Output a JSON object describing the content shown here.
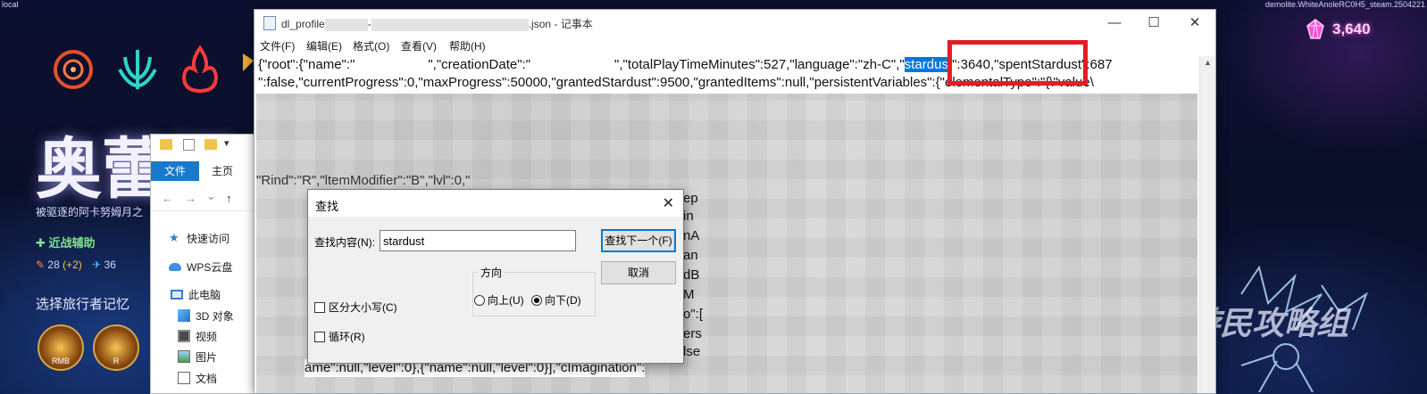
{
  "game": {
    "corner_left": "local",
    "corner_right": "demolite.WhiteAnoleRC0H5_steam.2504221",
    "title": "奥蕾娜",
    "subtitle": "被驱逐的阿卡努姆月之",
    "skill": "近战辅助",
    "stat1": "28",
    "stat1_delta": "(+2)",
    "stat2": "36",
    "memory_title": "选择旅行者记忆",
    "memory_keys": [
      "RMB",
      "R"
    ],
    "currency_value": "3,640",
    "watermark": "游民攻略组",
    "colors": {
      "currency_glow": "#ff4fd8",
      "skill_green": "#7ee38a"
    }
  },
  "explorer": {
    "ribbon": {
      "file": "文件",
      "home": "主页"
    },
    "nav": {
      "back": "←",
      "forward": "→",
      "dropdown": "⌄",
      "up": "↑"
    },
    "tree": [
      {
        "label": "快速访问",
        "icon": "star-icon"
      },
      {
        "label": "WPS云盘",
        "icon": "cloud-icon"
      },
      {
        "label": "此电脑",
        "icon": "computer-icon"
      },
      {
        "label": "3D 对象",
        "icon": "cube-icon"
      },
      {
        "label": "视频",
        "icon": "video-icon"
      },
      {
        "label": "图片",
        "icon": "picture-icon"
      },
      {
        "label": "文档",
        "icon": "document-icon"
      }
    ]
  },
  "notepad": {
    "title_prefix": "dl_profile",
    "title_suffix": ".json - 记事本",
    "controls": {
      "minimize": "—",
      "maximize": "☐",
      "close": "✕"
    },
    "menu": [
      "文件(F)",
      "编辑(E)",
      "格式(O)",
      "查看(V)",
      "帮助(H)"
    ],
    "line1_a": "{\"root\":{\"name\":\"",
    "line1_b": "\",\"creationDate\":\"",
    "line1_c": "\",\"totalPlayTimeMinutes\":527,\"language\":\"zh-C",
    "line1_d": "\",\"",
    "line1_hl": "stardust",
    "line1_e": "\":3640,\"spentStardust\":687",
    "line2": "\":false,\"currentProgress\":0,\"maxProgress\":50000,\"grantedStardust\":9500,\"grantedItems\":null,\"persistentVariables\":{\"elementalType\":\"{\\\"value\\",
    "fragments": [
      "\"Rind\":\"R\",\"ltemModifier\":\"B\",\"lvl\":0,\"",
      "ep",
      "in",
      "nA",
      "an",
      "dB",
      "M",
      "o\":[",
      "ers",
      "lse"
    ],
    "last_line": "ame\":null,\"level\":0},{\"name\":null,\"level\":0}],\"cImagination\":",
    "colors": {
      "highlight": "#0078d7",
      "annotation_box": "#e41c23"
    }
  },
  "find_dialog": {
    "title": "查找",
    "find_label": "查找内容(N):",
    "find_value": "stardust",
    "find_next": "查找下一个(F)",
    "cancel": "取消",
    "direction_label": "方向",
    "up_label": "向上(U)",
    "down_label": "向下(D)",
    "direction_selected": "向下(D)",
    "match_case": "区分大小写(C)",
    "wrap": "循环(R)",
    "match_case_checked": false,
    "wrap_checked": false
  }
}
